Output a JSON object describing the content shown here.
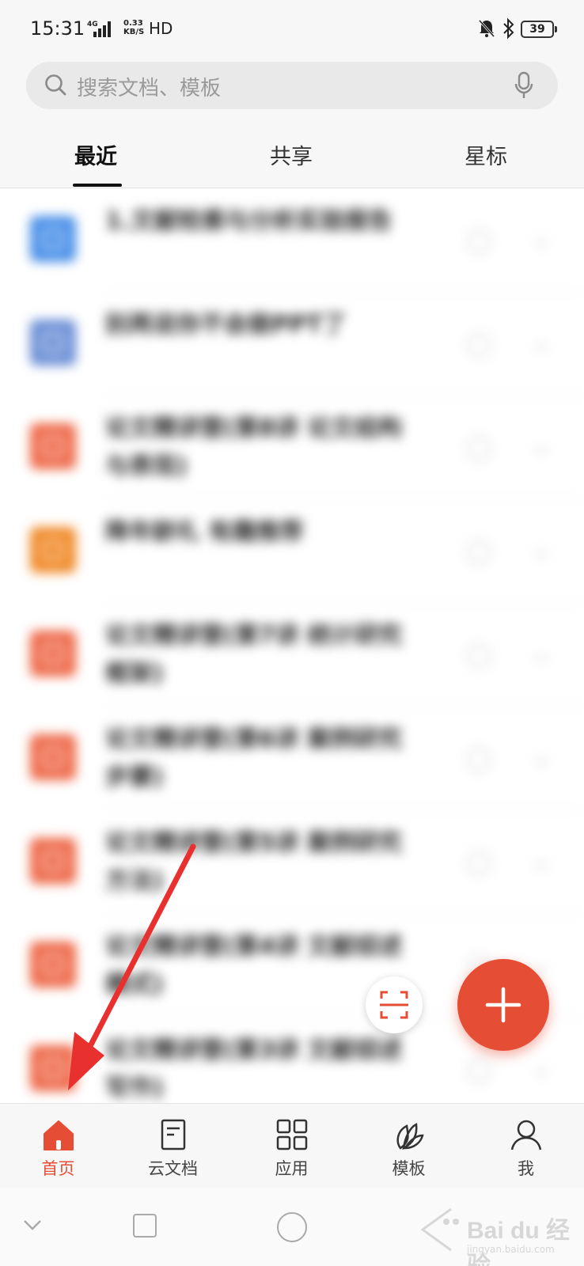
{
  "status_bar": {
    "time": "15:31",
    "network": "4G",
    "speed_top": "0.33",
    "speed_bottom": "KB/S",
    "hd": "HD",
    "battery": "39"
  },
  "search": {
    "placeholder": "搜索文档、模板"
  },
  "tabs": [
    {
      "label": "最近"
    },
    {
      "label": "共享"
    },
    {
      "label": "星标"
    }
  ],
  "files": [
    {
      "title": "1.文献检索与分析实验报告",
      "subtitle": "",
      "icon_color": "#4a90e8"
    },
    {
      "title": "别再说你不会做PPT了",
      "subtitle": "",
      "icon_color": "#6c8fd6"
    },
    {
      "title": "论文精讲营(第8讲 论文结构与表现)",
      "subtitle": "",
      "icon_color": "#ee6a4a"
    },
    {
      "title": "降年龄礼 有趣推荐",
      "subtitle": "",
      "icon_color": "#f08a2a"
    },
    {
      "title": "论文精讲营(第7讲 统计研究框架)",
      "subtitle": "",
      "icon_color": "#ee6a4a"
    },
    {
      "title": "论文精讲营(第6讲 案例研究步骤)",
      "subtitle": "",
      "icon_color": "#ee6a4a"
    },
    {
      "title": "论文精讲营(第5讲 案例研究方法)",
      "subtitle": "",
      "icon_color": "#ee6a4a"
    },
    {
      "title": "论文精讲营(第4讲 文献综述模式)",
      "subtitle": "",
      "icon_color": "#ee6a4a"
    },
    {
      "title": "论文精讲营(第3讲 文献综述写作)",
      "subtitle": "",
      "icon_color": "#ee6a4a"
    }
  ],
  "bottom_nav": [
    {
      "label": "首页",
      "icon": "home-icon",
      "active": true
    },
    {
      "label": "云文档",
      "icon": "cloud-doc-icon",
      "active": false
    },
    {
      "label": "应用",
      "icon": "apps-icon",
      "active": false
    },
    {
      "label": "模板",
      "icon": "template-icon",
      "active": false
    },
    {
      "label": "我",
      "icon": "profile-icon",
      "active": false
    }
  ],
  "watermark": {
    "brand": "Bai du 经验",
    "url": "jingyan.baidu.com"
  },
  "colors": {
    "accent": "#e64d35",
    "arrow": "#e8312f"
  }
}
